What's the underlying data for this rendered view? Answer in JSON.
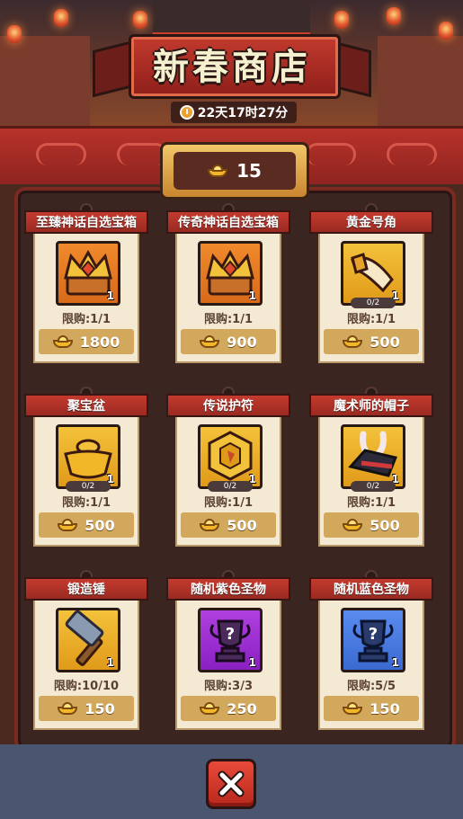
{
  "header": {
    "title": "新春商店",
    "timer": "22天17时27分"
  },
  "currency": {
    "balance": "15",
    "icon": "gold-ingot-icon"
  },
  "items": [
    {
      "name": "至臻神话自选宝箱",
      "icon": "crown-chest-icon",
      "frame": "orange",
      "qty": "1",
      "progress": "",
      "limit": "限购:1/1",
      "price": "1800"
    },
    {
      "name": "传奇神话自选宝箱",
      "icon": "crown-chest-icon",
      "frame": "orange",
      "qty": "1",
      "progress": "",
      "limit": "限购:1/1",
      "price": "900"
    },
    {
      "name": "黄金号角",
      "icon": "golden-horn-icon",
      "frame": "gold",
      "qty": "1",
      "progress": "0/2",
      "limit": "限购:1/1",
      "price": "500"
    },
    {
      "name": "聚宝盆",
      "icon": "treasure-bowl-icon",
      "frame": "gold",
      "qty": "1",
      "progress": "0/2",
      "limit": "限购:1/1",
      "price": "500"
    },
    {
      "name": "传说护符",
      "icon": "amulet-icon",
      "frame": "gold",
      "qty": "1",
      "progress": "0/2",
      "limit": "限购:1/1",
      "price": "500"
    },
    {
      "name": "魔术师的帽子",
      "icon": "magician-hat-icon",
      "frame": "gold",
      "qty": "1",
      "progress": "0/2",
      "limit": "限购:1/1",
      "price": "500"
    },
    {
      "name": "锻造锤",
      "icon": "hammer-icon",
      "frame": "gold",
      "qty": "1",
      "progress": "",
      "limit": "限购:10/10",
      "price": "150"
    },
    {
      "name": "随机紫色圣物",
      "icon": "purple-relic-icon",
      "frame": "purple",
      "qty": "1",
      "progress": "",
      "limit": "限购:3/3",
      "price": "250"
    },
    {
      "name": "随机蓝色圣物",
      "icon": "blue-relic-icon",
      "frame": "blue",
      "qty": "1",
      "progress": "",
      "limit": "限购:5/5",
      "price": "150"
    }
  ],
  "close": {
    "icon": "close-icon"
  }
}
